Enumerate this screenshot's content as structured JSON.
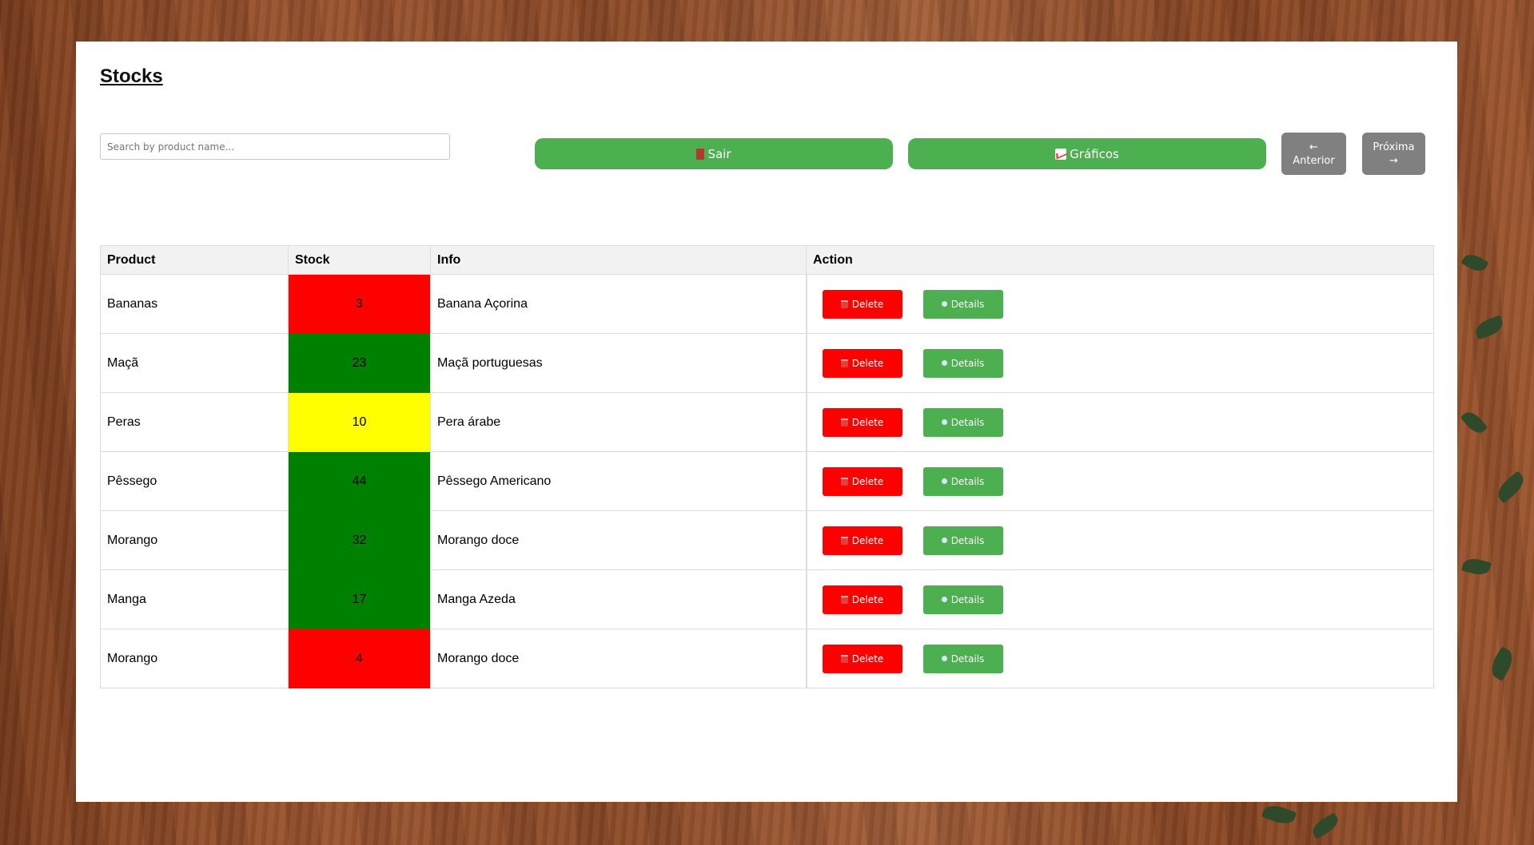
{
  "page": {
    "title": "Stocks"
  },
  "search": {
    "placeholder": "Search by product name..."
  },
  "toolbar": {
    "sair_label": "Sair",
    "graficos_label": "Gráficos",
    "anterior_arrow": "←",
    "anterior_label": "Anterior",
    "proxima_label": "Próxima",
    "proxima_arrow": "→"
  },
  "table": {
    "headers": {
      "product": "Product",
      "stock": "Stock",
      "info": "Info",
      "action": "Action"
    },
    "delete_label": "Delete",
    "details_label": "Details",
    "rows": [
      {
        "product": "Bananas",
        "stock": "3",
        "info": "Banana Açorina",
        "stock_color": "#ff0000"
      },
      {
        "product": "Maçã",
        "stock": "23",
        "info": "Maçã portuguesas",
        "stock_color": "#008000"
      },
      {
        "product": "Peras",
        "stock": "10",
        "info": "Pera árabe",
        "stock_color": "#ffff00"
      },
      {
        "product": "Pêssego",
        "stock": "44",
        "info": "Pêssego Americano",
        "stock_color": "#008000"
      },
      {
        "product": "Morango",
        "stock": "32",
        "info": "Morango doce",
        "stock_color": "#008000"
      },
      {
        "product": "Manga",
        "stock": "17",
        "info": "Manga Azeda",
        "stock_color": "#008000"
      },
      {
        "product": "Morango",
        "stock": "4",
        "info": "Morango doce",
        "stock_color": "#ff0000"
      }
    ]
  },
  "colors": {
    "primary_green": "#4caf50",
    "delete_red": "#ff0000",
    "nav_gray": "#808080"
  },
  "icons": {
    "sair": "door-icon",
    "graficos": "chart-increasing-icon",
    "delete": "trash-icon",
    "details": "lightbulb-icon"
  }
}
